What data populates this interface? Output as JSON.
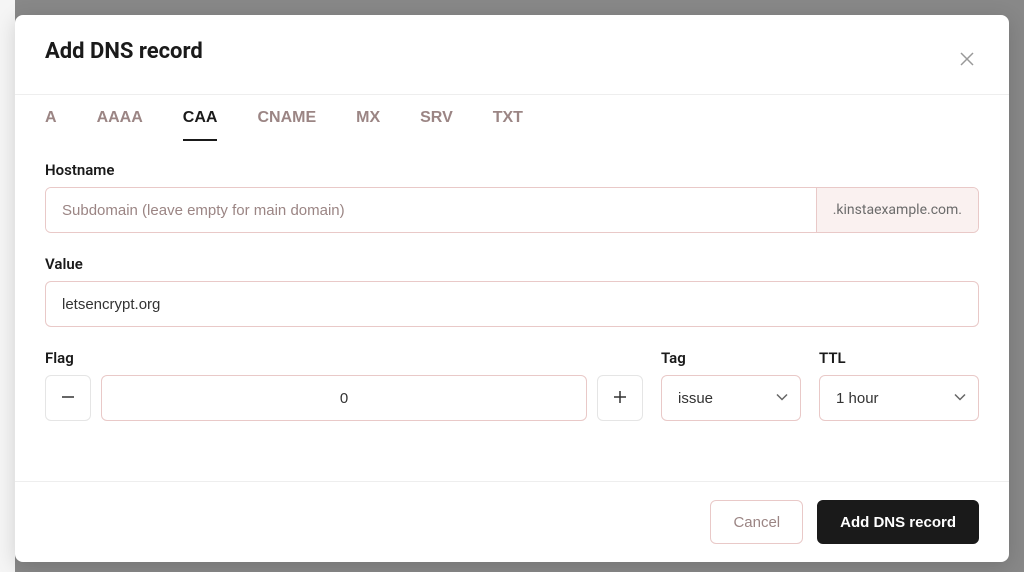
{
  "modal": {
    "title": "Add DNS record"
  },
  "tabs": [
    {
      "label": "A",
      "active": false
    },
    {
      "label": "AAAA",
      "active": false
    },
    {
      "label": "CAA",
      "active": true
    },
    {
      "label": "CNAME",
      "active": false
    },
    {
      "label": "MX",
      "active": false
    },
    {
      "label": "SRV",
      "active": false
    },
    {
      "label": "TXT",
      "active": false
    }
  ],
  "form": {
    "hostname": {
      "label": "Hostname",
      "placeholder": "Subdomain (leave empty for main domain)",
      "value": "",
      "suffix": ".kinstaexample.com."
    },
    "value": {
      "label": "Value",
      "value": "letsencrypt.org"
    },
    "flag": {
      "label": "Flag",
      "value": "0"
    },
    "tag": {
      "label": "Tag",
      "value": "issue"
    },
    "ttl": {
      "label": "TTL",
      "value": "1 hour"
    }
  },
  "footer": {
    "cancel": "Cancel",
    "submit": "Add DNS record"
  }
}
